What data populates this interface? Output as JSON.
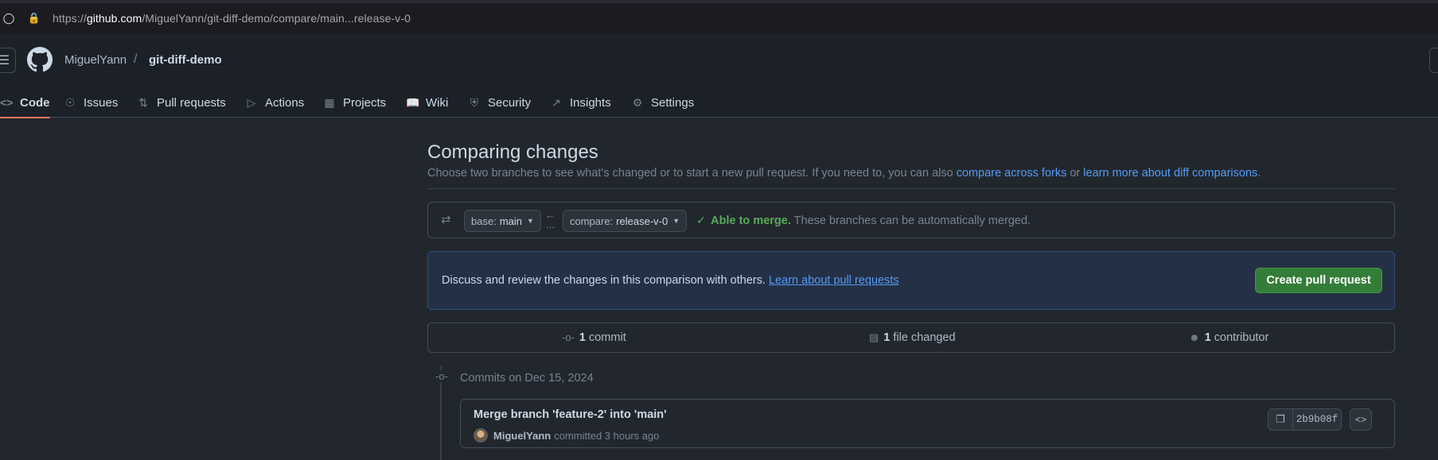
{
  "browser": {
    "url_prefix": "https://",
    "url_domain": "github.com",
    "url_path": "/MiguelYann/git-diff-demo/compare/main...release-v-0"
  },
  "header": {
    "owner": "MiguelYann",
    "separator": "/",
    "repo": "git-diff-demo"
  },
  "tabs": [
    {
      "label": "Code",
      "icon": "code-icon"
    },
    {
      "label": "Issues",
      "icon": "issue-opened-icon"
    },
    {
      "label": "Pull requests",
      "icon": "git-pull-request-icon"
    },
    {
      "label": "Actions",
      "icon": "play-icon"
    },
    {
      "label": "Projects",
      "icon": "table-icon"
    },
    {
      "label": "Wiki",
      "icon": "book-icon"
    },
    {
      "label": "Security",
      "icon": "shield-icon"
    },
    {
      "label": "Insights",
      "icon": "graph-icon"
    },
    {
      "label": "Settings",
      "icon": "gear-icon"
    }
  ],
  "compare": {
    "title": "Comparing changes",
    "subtitle_text": "Choose two branches to see what’s changed or to start a new pull request. If you need to, you can also ",
    "link_forks": "compare across forks",
    "subtitle_or": " or ",
    "link_learn": "learn more about diff comparisons",
    "subtitle_end": ".",
    "base_label": "base:",
    "base_value": "main",
    "compare_label": "compare:",
    "compare_value": "release-v-0",
    "arrow": "←",
    "dots": "...",
    "merge_ok": "Able to merge.",
    "merge_text": " These branches can be automatically merged."
  },
  "discuss": {
    "text": "Discuss and review the changes in this comparison with others. ",
    "link": "Learn about pull requests",
    "button": "Create pull request"
  },
  "stats": {
    "commits_count": "1",
    "commits_label": " commit",
    "files_count": "1",
    "files_label": " file changed",
    "contributors_count": "1",
    "contributors_label": " contributor"
  },
  "commits": {
    "group_label": "Commits on Dec 15, 2024",
    "items": [
      {
        "title": "Merge branch 'feature-2' into 'main'",
        "author": "MiguelYann",
        "meta": "committed 3 hours ago",
        "sha": "2b9b08f"
      }
    ]
  },
  "colors": {
    "background": "#22272e",
    "header": "#1c2128",
    "accent_link": "#539bf5",
    "success": "#57ab5a",
    "primary_button": "#347d39",
    "active_tab_underline": "#ec775c"
  }
}
